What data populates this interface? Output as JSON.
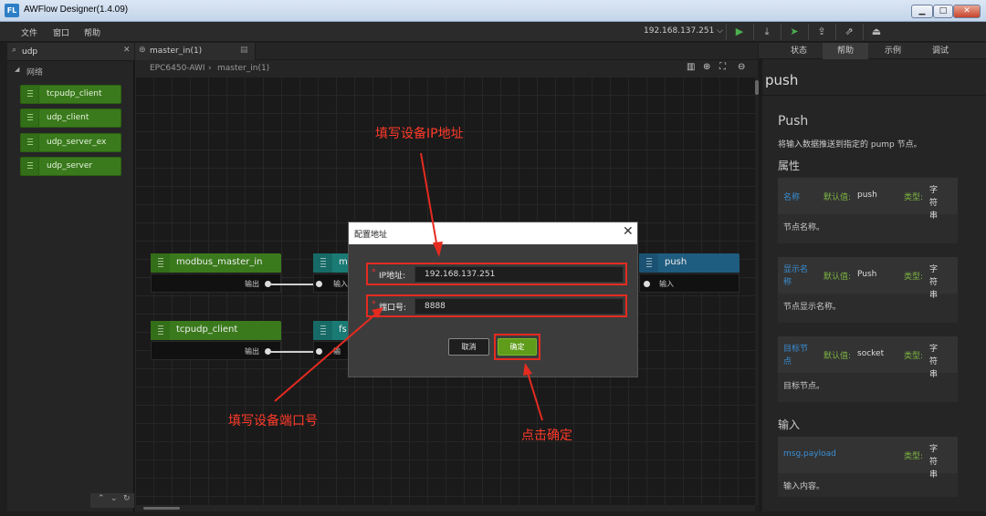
{
  "window": {
    "title": "AWFlow Designer(1.4.09)",
    "logo": "FL",
    "btn_min": "▁",
    "btn_max": "□",
    "btn_close": "✕"
  },
  "menu": {
    "items": [
      "文件",
      "窗口",
      "帮助"
    ],
    "ip_select": "192.168.137.251 ⌵",
    "toolbar_icons": [
      "play-icon",
      "download-icon",
      "deploy-icon",
      "upload-icon",
      "export-icon",
      "stop-icon"
    ]
  },
  "palette": {
    "search_value": "udp",
    "category": "网络",
    "nodes": [
      "tcpudp_client",
      "udp_client",
      "udp_server_ex",
      "udp_server"
    ],
    "footer": [
      "⌃",
      "⌄",
      "↻"
    ]
  },
  "workspace": {
    "tab_label": "master_in(1)",
    "breadcrumb": [
      "EPC6450-AWI",
      "›",
      "master_in(1)"
    ],
    "nodes": [
      {
        "label": "modbus_master_in",
        "port_out": "输出",
        "color": "green"
      },
      {
        "label": "mo",
        "port_in": "输入",
        "color": "teal"
      },
      {
        "label": "push",
        "port_in": "输入",
        "color": "blue"
      },
      {
        "label": "tcpudp_client",
        "port_out": "输出",
        "color": "green"
      },
      {
        "label": "fs",
        "port_in": "输",
        "color": "teal"
      }
    ]
  },
  "dialog": {
    "title": "配置地址",
    "ip_label": "IP地址:",
    "ip_value": "192.168.137.251",
    "port_label": "端口号:",
    "port_value": "8888",
    "required_mark": "*",
    "cancel": "取消",
    "ok": "确定"
  },
  "annotations": {
    "ip": "填写设备IP地址",
    "port": "填写设备端口号",
    "ok": "点击确定",
    "color": "#e52b20"
  },
  "info_panel": {
    "tabs": [
      "状态",
      "帮助",
      "示例",
      "调试"
    ],
    "active_tab": "帮助",
    "node_name": "push",
    "heading": "Push",
    "description": "将输入数据推送到指定的 pump 节点。",
    "props_heading": "属性",
    "default_label": "默认值:",
    "type_label": "类型:",
    "properties": [
      {
        "name": "名称",
        "default": "push",
        "type": "字符串",
        "desc": "节点名称。"
      },
      {
        "name": "显示名称",
        "default": "Push",
        "type": "字符串",
        "desc": "节点显示名称。"
      },
      {
        "name": "目标节点",
        "default": "socket",
        "type": "字符串",
        "desc": "目标节点。"
      }
    ],
    "input_heading": "输入",
    "input_props": [
      {
        "name": "msg.payload",
        "type": "字符串",
        "desc": "输入内容。"
      }
    ]
  }
}
